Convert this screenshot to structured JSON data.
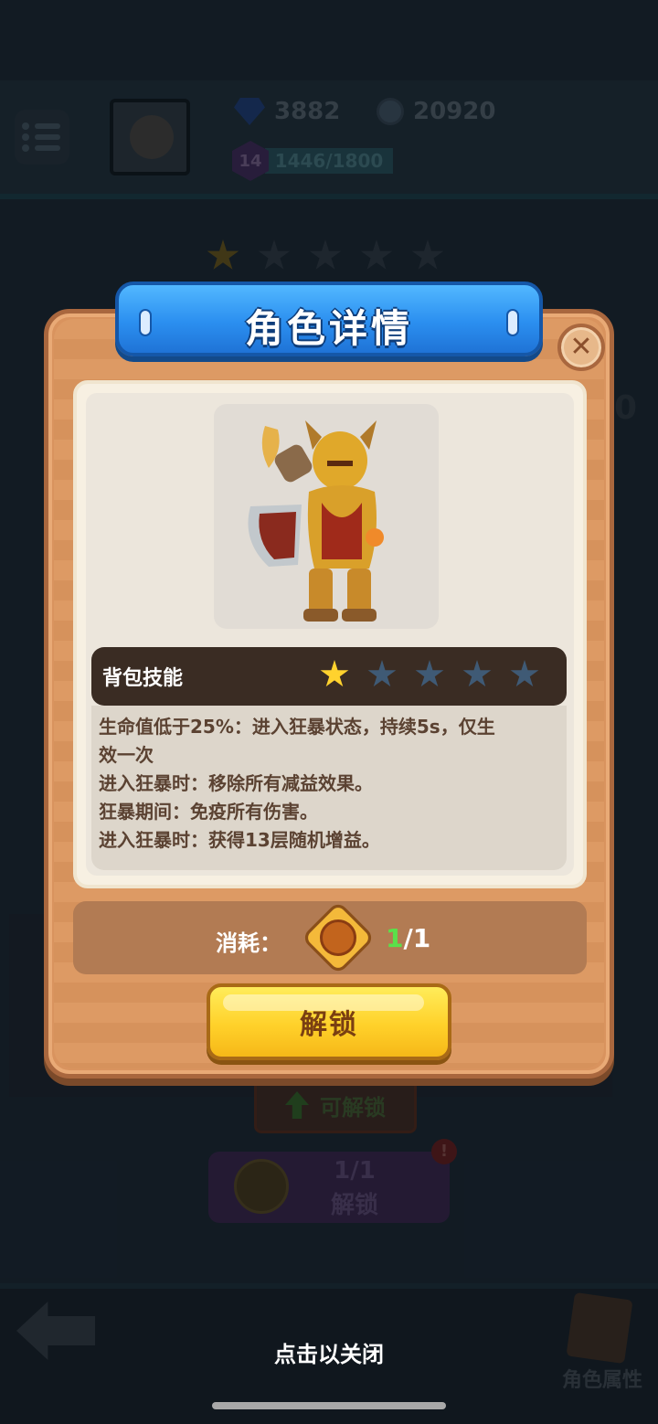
{
  "hud": {
    "gems": "3882",
    "coins": "20920",
    "level": "14",
    "xp": "1446/1800",
    "hero_stars_filled": 1,
    "hero_stars_total": 5,
    "side_value": "0"
  },
  "background_buttons": {
    "unlockable_label": "可解锁",
    "count_label": "1/1",
    "unlock_label": "解锁",
    "badge": "!",
    "attributes_label": "角色属性"
  },
  "dialog": {
    "title": "角色详情",
    "close_glyph": "✕",
    "skill": {
      "title": "背包技能",
      "stars_filled": 1,
      "stars_total": 5,
      "lines": [
        "生命值低于25%：进入狂暴状态，持续5s，仅生",
        "效一次",
        "进入狂暴时：移除所有减益效果。",
        "狂暴期间：免疫所有伤害。",
        "进入狂暴时：获得13层随机增益。"
      ]
    },
    "cost": {
      "label": "消耗：",
      "have": "1",
      "need": "/1"
    },
    "unlock_button": "解锁"
  },
  "footer": {
    "tap_to_close": "点击以关闭"
  },
  "colors": {
    "banner_blue": "#2b8ff0",
    "panel_tan": "#d9935e",
    "button_yellow": "#ffd12a",
    "star_gold": "#ffd22e",
    "have_green": "#5ae04a"
  }
}
